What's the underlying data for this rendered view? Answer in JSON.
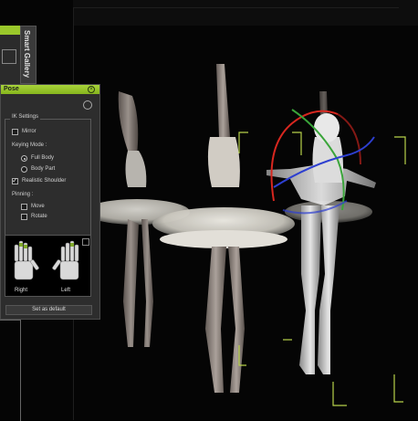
{
  "gallery": {
    "label": "Smart Gallery"
  },
  "pose_panel": {
    "title": "Pose",
    "ik_settings_label": "IK Settings",
    "mirror_label": "Mirror",
    "mirror_checked": false,
    "keying_mode_label": "Keying Mode :",
    "keying_options": [
      {
        "label": "Full Body",
        "selected": true
      },
      {
        "label": "Body Part",
        "selected": false
      }
    ],
    "realistic_shoulder_label": "Realistic Shoulder",
    "realistic_shoulder_checked": true,
    "pinning_label": "Pinning :",
    "pin_move_label": "Move",
    "pin_move_checked": false,
    "pin_rotate_label": "Rotate",
    "pin_rotate_checked": false,
    "hand_right_label": "Right",
    "hand_left_label": "Left",
    "set_default_label": "Set as default"
  },
  "colors": {
    "accent": "#9ac82b",
    "panel_bg": "#2d2d2d",
    "viewport_bg": "#050505",
    "gizmo_red": "#d8271f",
    "gizmo_green": "#3aa53a",
    "gizmo_blue": "#2d3fd0",
    "frame_guides": "#b8d24a"
  }
}
